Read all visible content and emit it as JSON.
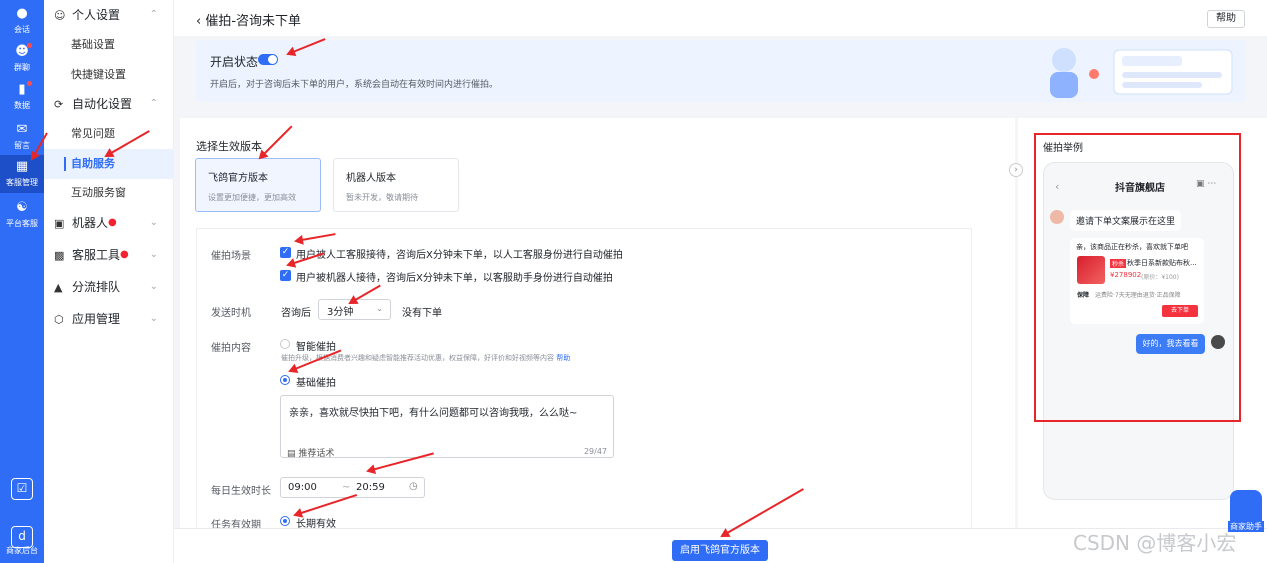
{
  "rail": {
    "items": [
      {
        "label": "会话",
        "icon": "chat-icon"
      },
      {
        "label": "群聊",
        "icon": "group-icon"
      },
      {
        "label": "数据",
        "icon": "chart-icon"
      },
      {
        "label": "留言",
        "icon": "mail-icon"
      },
      {
        "label": "客服管理",
        "icon": "grid-icon"
      },
      {
        "label": "平台客服",
        "icon": "headset-icon"
      }
    ],
    "bottom_label": "商家后台"
  },
  "menu": {
    "personal": "个人设置",
    "basic": "基础设置",
    "shortcut": "快捷键设置",
    "automation": "自动化设置",
    "faq": "常见问题",
    "self_service": "自助服务",
    "interactive": "互动服务窗",
    "robot": "机器人",
    "tools": "客服工具",
    "routing": "分流排队",
    "apps": "应用管理"
  },
  "header": {
    "title": "催拍-咨询未下单",
    "help": "帮助"
  },
  "banner": {
    "status_label": "开启状态",
    "desc": "开启后，对于咨询后未下单的用户，系统会自动在有效时间内进行催拍。"
  },
  "version": {
    "title": "选择生效版本",
    "official": {
      "name": "飞鸽官方版本",
      "sub": "设置更加便捷，更加高效"
    },
    "robot": {
      "name": "机器人版本",
      "sub": "暂未开发，敬请期待"
    }
  },
  "form": {
    "scene_label": "催拍场景",
    "scene_1": "用户被人工客服接待，咨询后X分钟未下单，以人工客服身份进行自动催拍",
    "scene_2": "用户被机器人接待，咨询后X分钟未下单，以客服助手身份进行自动催拍",
    "timing_label": "发送时机",
    "timing_prefix": "咨询后",
    "timing_value": "3分钟",
    "timing_suffix": "没有下单",
    "content_label": "催拍内容",
    "smart": "智能催拍",
    "smart_desc": "催拍升级，根据消费者兴趣和疑虑智能推荐活动优惠，权益保障，好评价和好视频等内容",
    "help_link": "帮助",
    "basic": "基础催拍",
    "message": "亲亲，喜欢就尽快拍下吧，有什么问题都可以咨询我哦，么么哒~",
    "suggest": "推荐话术",
    "counter": "29/47",
    "daily_label": "每日生效时长",
    "start_time": "09:00",
    "range_sep": "~",
    "end_time": "20:59",
    "validity_label": "任务有效期",
    "validity_value": "长期有效"
  },
  "footer": {
    "enable": "启用飞鸽官方版本"
  },
  "preview": {
    "title": "催拍举例",
    "shop": "抖音旗舰店",
    "invite": "邀请下单文案展示在这里",
    "product_intro": "亲，该商品正在秒杀，喜欢就下单吧",
    "tag": "秒杀",
    "product_name": "秋季日系新款贴布秋...",
    "price": "¥278902",
    "orig_price": "(原价：¥100)",
    "guarantee_tag": "保障",
    "guarantee": "运费险·7天无理由退货·正品保障",
    "buy": "去下单",
    "reply": "好的，我去看看"
  },
  "watermark": "CSDN @博客小宏",
  "robot_label": "商家助手",
  "colors": {
    "primary": "#2f6df6",
    "highlight": "#e8262a"
  }
}
